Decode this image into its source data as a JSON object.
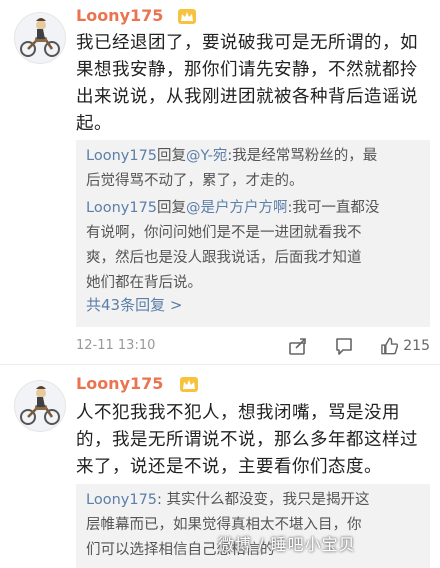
{
  "comments": [
    {
      "username": "Loony175",
      "text_lines": [
        "我已经退团了，要说破我可是无所谓的，如",
        "果想我安静，那你们请先安静，不然就都拎",
        "出来说说，从我刚进团就被各种背后造谣说",
        "起。"
      ],
      "replies": [
        {
          "author": "Loony175",
          "connector": "回复",
          "target": "@Y-宛",
          "lines": [
            ":我是经常骂粉丝的，最",
            "后觉得骂不动了，累了，才走的。"
          ]
        },
        {
          "author": "Loony175",
          "connector": "回复",
          "target": "@是户方户方啊",
          "lines": [
            ":我可一直都没",
            "有说啊，你问问她们是不是一进团就看我不",
            "爽，然后也是没人跟我说话，后面我才知道",
            "她们都在背后说。"
          ]
        }
      ],
      "more_replies": "共43条回复 >",
      "time": "12-11 13:10",
      "like_count": "215"
    },
    {
      "username": "Loony175",
      "text_lines": [
        "人不犯我我不犯人，想我闭嘴，骂是没用",
        "的，我是无所谓说不说，那么多年都这样过",
        "来了，说还是不说，主要看你们态度。"
      ],
      "replies": [
        {
          "author": "Loony175",
          "lines": [
            ": 其实什么都没变，我只是揭开这",
            "层帷幕而已，如果觉得真相太不堪入目，你",
            "们可以选择相信自己想相信的"
          ]
        }
      ]
    }
  ],
  "watermark": "微博 / 睡吧小宝贝",
  "colors": {
    "username": "#eb7350",
    "link": "#5b7fa8",
    "reply_bg": "#f2f2f2"
  },
  "icons": [
    "avatar-motorcycle-icon",
    "vip-crown-icon",
    "share-icon",
    "comment-icon",
    "thumbs-up-icon"
  ]
}
